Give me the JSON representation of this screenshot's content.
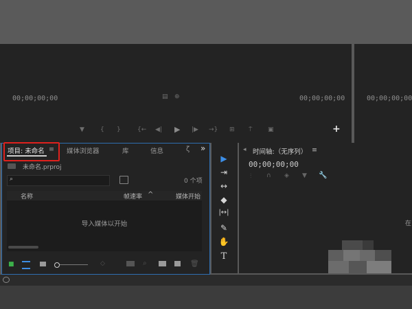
{
  "source_monitor": {
    "timecode_left": "00;00;00;00",
    "timecode_right": "00;00;00;00"
  },
  "program_monitor": {
    "timecode": "00;00;00;00"
  },
  "transport_glyphs": [
    "▼",
    "{",
    "}",
    "{←",
    "◀|",
    "▶",
    "|▶",
    "→}",
    "⊞",
    "⍑",
    "▣"
  ],
  "add_button": "+",
  "project_panel": {
    "tabs": [
      "项目: 未命名",
      "媒体浏览器",
      "库",
      "信息",
      "ζ"
    ],
    "overflow": "»",
    "menu_icon": "≡",
    "file_name": "未命名.prproj",
    "item_count": "0 个项",
    "columns": [
      "名称",
      "帧速率",
      "媒体开始"
    ],
    "sort_glyph": "^",
    "empty_message": "导入媒体以开始"
  },
  "tools": [
    "▶",
    "⇥",
    "↔",
    "◆",
    "|↔|",
    "✎",
    "✋",
    "T"
  ],
  "timeline_panel": {
    "title": "时间轴:（无序列）",
    "menu_icon": "≡",
    "collapse_glyph": "◂",
    "timecode": "00;00;00;00",
    "edge_text": "在"
  },
  "colors": {
    "highlight_red": "#e0211d",
    "selection_blue": "#3d8ee6",
    "panel": "#232323",
    "background": "#595959"
  }
}
